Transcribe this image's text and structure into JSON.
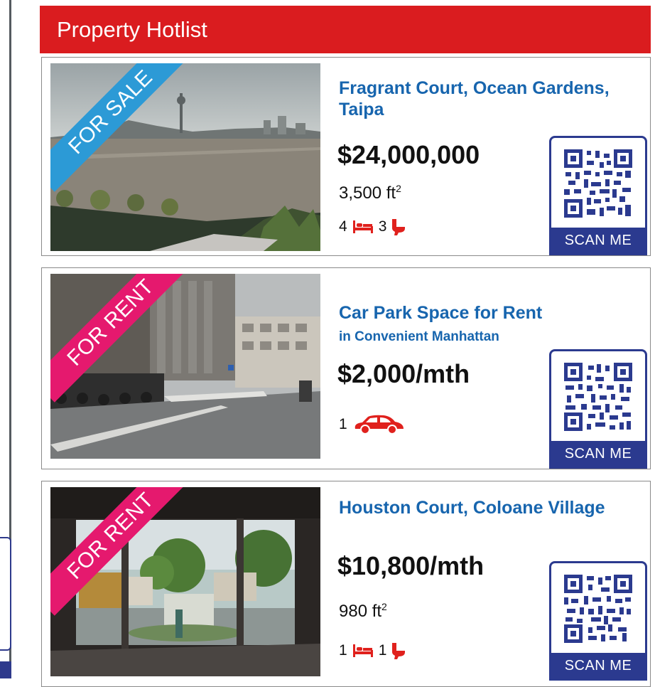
{
  "header": {
    "title": "Property Hotlist"
  },
  "listings": [
    {
      "tag": "FOR SALE",
      "title": "Fragrant Court, Ocean Gardens, Taipa",
      "subtitle": "",
      "price": "$24,000,000",
      "area": "3,500 ft",
      "area_unit_sup": "2",
      "bedrooms": "4",
      "bathrooms": "3",
      "qr_label": "SCAN ME"
    },
    {
      "tag": "FOR RENT",
      "title": "Car Park Space for Rent",
      "subtitle": "in Convenient Manhattan",
      "price": "$2,000/mth",
      "parking": "1",
      "qr_label": "SCAN ME"
    },
    {
      "tag": "FOR RENT",
      "title": "Houston Court, Coloane Village",
      "subtitle": "",
      "price": "$10,800/mth",
      "area": "980 ft",
      "area_unit_sup": "2",
      "bedrooms": "1",
      "bathrooms": "1",
      "qr_label": "SCAN ME"
    }
  ],
  "colors": {
    "header_red": "#da1c1f",
    "title_blue": "#1765ae",
    "sale_ribbon": "#2c9ad6",
    "rent_ribbon": "#e5196e",
    "qr_navy": "#2b3a8f",
    "icon_red": "#e0211d"
  },
  "icons": [
    "bed-icon",
    "toilet-icon",
    "car-icon",
    "qr-code-icon"
  ]
}
